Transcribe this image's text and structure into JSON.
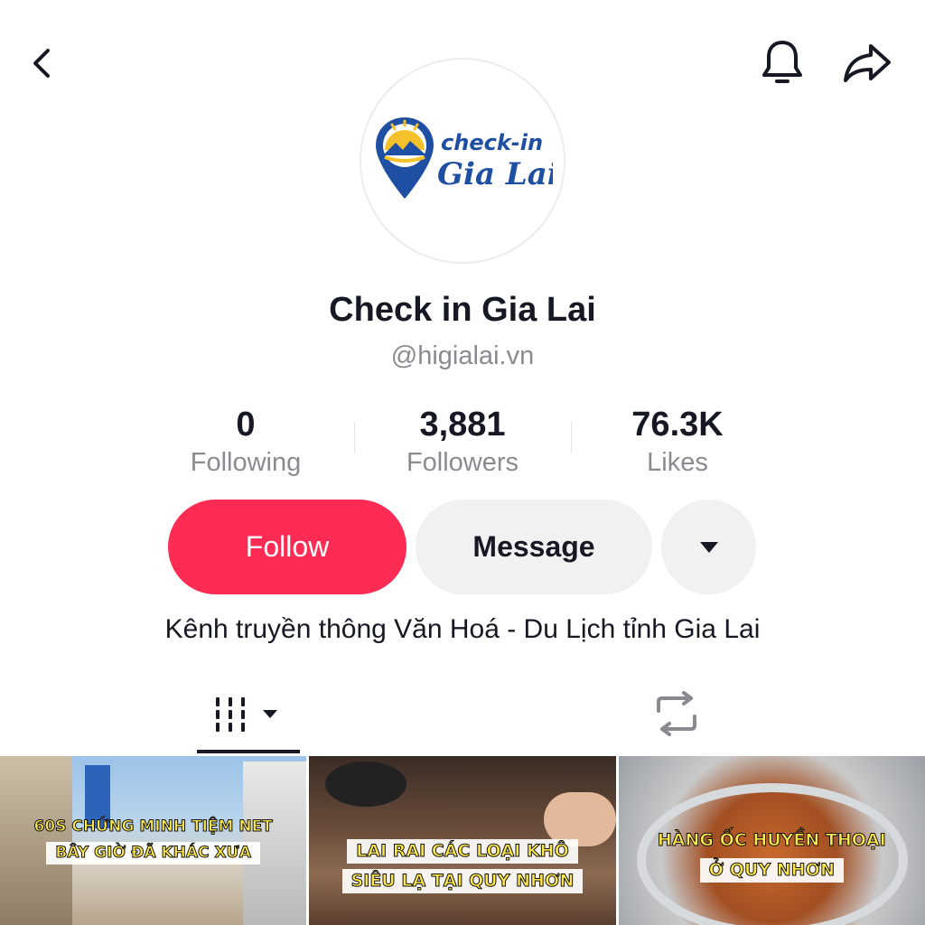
{
  "profile": {
    "avatar_logo_line1": "check-in",
    "avatar_logo_line2": "Gia Lai",
    "name": "Check in Gia Lai",
    "handle": "@higialai.vn",
    "bio": "Kênh truyền thông Văn Hoá - Du Lịch tỉnh Gia Lai"
  },
  "stats": {
    "following": {
      "value": "0",
      "label": "Following"
    },
    "followers": {
      "value": "3,881",
      "label": "Followers"
    },
    "likes": {
      "value": "76.3K",
      "label": "Likes"
    }
  },
  "actions": {
    "follow_label": "Follow",
    "message_label": "Message"
  },
  "icons": {
    "back": "back-chevron-icon",
    "bell": "bell-icon",
    "share": "share-arrow-icon",
    "more": "caret-down-icon",
    "videos_tab": "grid-columns-icon",
    "reposts_tab": "repost-icon"
  },
  "colors": {
    "accent": "#fe2c55",
    "secondary_button": "#f1f1f2",
    "muted_text": "#8a8b91",
    "logo_blue": "#1f4fa3",
    "logo_yellow": "#f5c12a"
  },
  "videos": [
    {
      "line1": "60s chứng minh tiệm net",
      "line2": "bây giờ đã khác xưa"
    },
    {
      "line1": "lai rai các loại khô",
      "line2": "siêu lạ tại quy nhơn"
    },
    {
      "line1": "hàng ốc huyền thoại",
      "line2": "ở quy nhơn"
    }
  ]
}
